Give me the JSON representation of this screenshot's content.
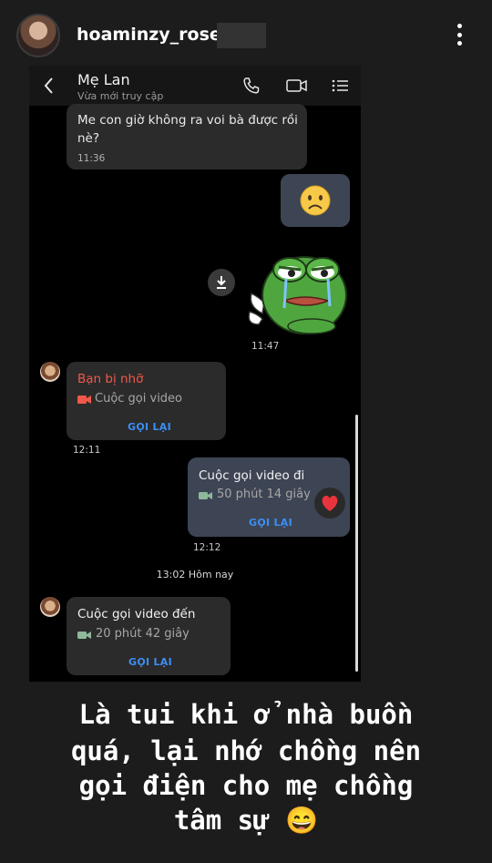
{
  "story": {
    "username": "hoaminzy_rose"
  },
  "chat": {
    "contact_name": "Mẹ Lan",
    "contact_status": "Vừa mới truy cập",
    "msg1_line1": "Me con giờ không ra voi bà được rồi",
    "msg1_line2": "nè?",
    "msg1_time": "11:36",
    "sticker_time": "11:47",
    "missed_label": "Bạn bị nhỡ",
    "missed_sub": "Cuộc gọi video",
    "missed_callback": "GỌI LẠI",
    "missed_time": "12:11",
    "out_title": "Cuộc gọi video đi",
    "out_sub": "50 phút 14 giây",
    "out_callback": "GỌI LẠI",
    "out_time": "12:12",
    "divider": "13:02 Hôm nay",
    "in_title": "Cuộc gọi video đến",
    "in_sub": "20 phút 42 giây",
    "in_callback": "GỌI LẠI"
  },
  "caption": {
    "line1": "Là tui khi ở nhà buồn",
    "line2": "quá, lại nhớ chồng nên",
    "line3": "gọi điện cho mẹ chồng",
    "line4": "tâm sự 😄"
  },
  "colors": {
    "missed_red": "#f0584a",
    "callback_blue": "#3c8ef5",
    "outgoing_bubble": "#3d4554"
  },
  "icons": [
    "back-icon",
    "phone-icon",
    "video-icon",
    "menu-icon",
    "download-icon",
    "video-camera-icon",
    "heart-icon"
  ]
}
